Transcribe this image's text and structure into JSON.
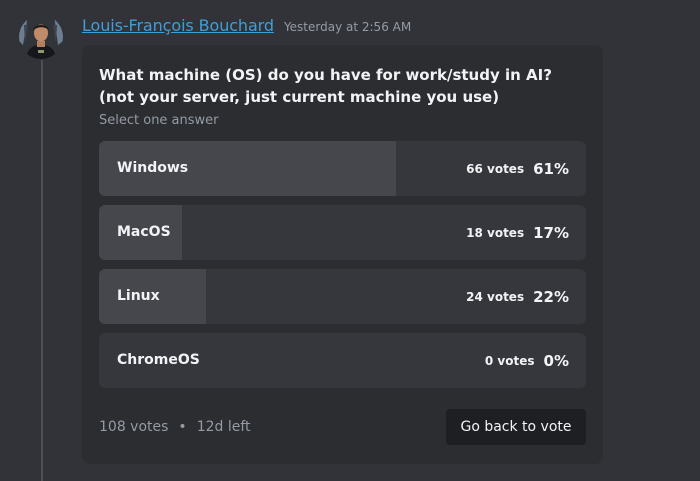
{
  "message": {
    "author": "Louis-François Bouchard",
    "timestamp": "Yesterday at 2:56 AM"
  },
  "poll": {
    "question": "What machine (OS) do you have for work/study in AI? (not your server, just current machine you use)",
    "instruction": "Select one answer",
    "answers": [
      {
        "label": "Windows",
        "votes": "66 votes",
        "percent": "61%",
        "fraction": 0.61
      },
      {
        "label": "MacOS",
        "votes": "18 votes",
        "percent": "17%",
        "fraction": 0.17
      },
      {
        "label": "Linux",
        "votes": "24 votes",
        "percent": "22%",
        "fraction": 0.22
      },
      {
        "label": "ChromeOS",
        "votes": "0 votes",
        "percent": "0%",
        "fraction": 0
      }
    ],
    "total_votes": "108 votes",
    "separator": "•",
    "time_left": "12d left",
    "back_button_label": "Go back to vote"
  },
  "colors": {
    "background": "#323339",
    "card": "#2b2d31",
    "answer_bg": "#35373c",
    "answer_fill": "#45474d",
    "link": "#3e9ed8",
    "muted": "#949ba4"
  }
}
